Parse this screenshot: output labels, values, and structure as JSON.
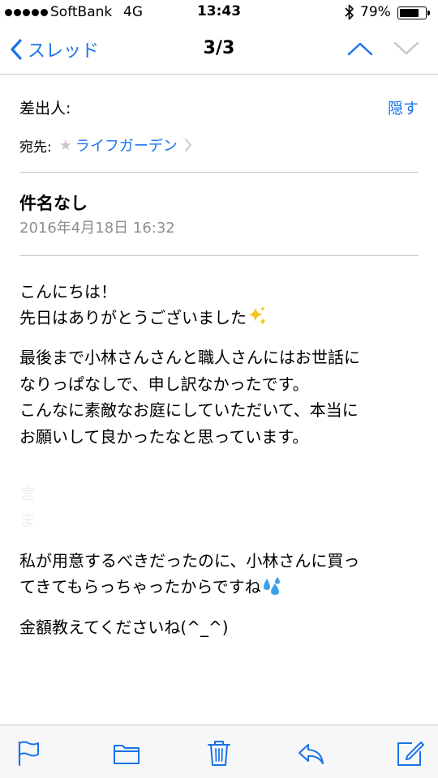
{
  "status_bar": {
    "carrier": "SoftBank",
    "network": "4G",
    "time": "13:43",
    "battery_percent": "79%",
    "battery_level": 0.79,
    "signal_bars": 5
  },
  "nav": {
    "back_label": "スレッド",
    "counter": "3/3"
  },
  "header": {
    "from_label": "差出人:",
    "hide_label": "隠す",
    "to_label": "宛先:",
    "recipient": "ライフガーデン",
    "subject": "件名なし",
    "date": "2016年4月18日 16:32"
  },
  "body": {
    "p1_l1": "こんにちは！",
    "p1_l2": "先日はありがとうございました",
    "p2_l1": "最後まで小林さんさんと職人さんにはお世話に",
    "p2_l2": "なりっぱなしで、申し訳なかったです。",
    "p2_l3": "こんなに素敵なお庭にしていただいて、本当に",
    "p2_l4": "お願いして良かったなと思っています。",
    "faint_l1": "言",
    "faint_l2": "ま",
    "p3_l1": "私が用意するべきだったのに、小林さんに買っ",
    "p3_l2": "てきてもらっちゃったからですね",
    "p4_l1": "金額教えてくださいね(^_^)"
  },
  "colors": {
    "accent": "#1a73e8",
    "separator": "#c8c7cc",
    "secondary_text": "#8e8e93",
    "sparkle": "#f5c518",
    "sweat_drops": "#3aa0e8"
  },
  "toolbar": {
    "icons": [
      "flag-icon",
      "folder-icon",
      "trash-icon",
      "reply-icon",
      "compose-icon"
    ]
  }
}
